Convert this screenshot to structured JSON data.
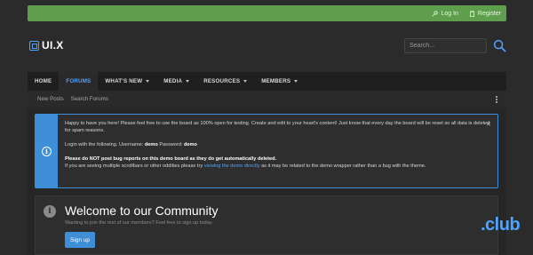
{
  "topbar": {
    "login": "Log In",
    "register": "Register"
  },
  "header": {
    "logo_text": "UI.X",
    "search_placeholder": "Search..."
  },
  "nav": {
    "items": [
      {
        "label": "HOME",
        "caret": false
      },
      {
        "label": "FORUMS",
        "caret": false
      },
      {
        "label": "WHAT'S NEW",
        "caret": true
      },
      {
        "label": "MEDIA",
        "caret": true
      },
      {
        "label": "RESOURCES",
        "caret": true
      },
      {
        "label": "MEMBERS",
        "caret": true
      }
    ],
    "active_index": 1
  },
  "subnav": {
    "items": [
      "New Posts",
      "Search Forums"
    ]
  },
  "notice": {
    "line1": "Happy to have you here! Please feel free to use the board as 100% open for testing. Create and edit to your heart's content! Just know that every day the board will be reset so all data is deleted for spam reasons.",
    "login_prefix": "Login with the following. Username: ",
    "username": "demo",
    "password_label": " Password: ",
    "password": "demo",
    "warning": "Please do NOT post bug reports on this demo board as they do get automatically deleted.",
    "scroll_prefix": "If you are seeing multiple scrollbars or other oddities please try ",
    "scroll_link": "viewing the demo directly",
    "scroll_suffix": " as it may be related to the demo wrapper rather than a bug with the theme.",
    "close": "✕"
  },
  "welcome": {
    "title": "Welcome to our Community",
    "subtitle": "Wanting to join the rest of our members? Feel free to sign up today.",
    "button": "Sign up"
  },
  "watermark": ".club",
  "colors": {
    "accent": "#3f8fd8",
    "topbar": "#5f9e4c",
    "background": "#2b2b2b"
  }
}
